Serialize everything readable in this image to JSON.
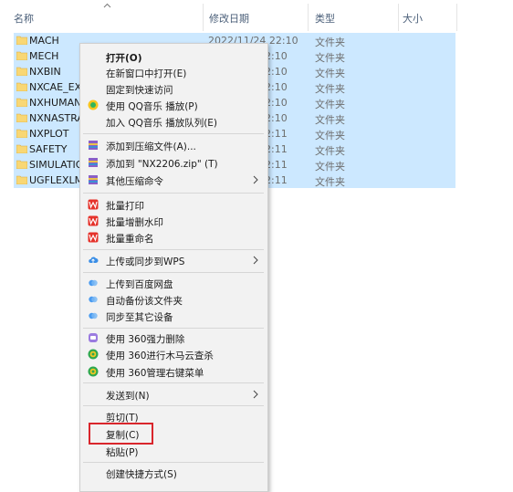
{
  "header": {
    "col_name": "名称",
    "col_date": "修改日期",
    "col_type": "类型",
    "col_size": "大小"
  },
  "files": [
    {
      "name": "MACH",
      "date": "2022/11/24 22:10",
      "type": "文件夹"
    },
    {
      "name": "MECH",
      "date": "2:10",
      "type": "文件夹"
    },
    {
      "name": "NXBIN",
      "date": "2:10",
      "type": "文件夹"
    },
    {
      "name": "NXCAE_EXT",
      "date": "2:10",
      "type": "文件夹"
    },
    {
      "name": "NXHUMAN",
      "date": "2:10",
      "type": "文件夹"
    },
    {
      "name": "NXNASTRA",
      "date": "2:10",
      "type": "文件夹"
    },
    {
      "name": "NXPLOT",
      "date": "2:11",
      "type": "文件夹"
    },
    {
      "name": "SAFETY",
      "date": "2:11",
      "type": "文件夹"
    },
    {
      "name": "SIMULATIO",
      "date": "2:11",
      "type": "文件夹"
    },
    {
      "name": "UGFLEXLM",
      "date": "2:11",
      "type": "文件夹"
    }
  ],
  "menu": {
    "open": "打开(O)",
    "open_new_window": "在新窗口中打开(E)",
    "pin_quick_access": "固定到快速访问",
    "qq_play": "使用 QQ音乐 播放(P)",
    "qq_queue": "加入 QQ音乐 播放队列(E)",
    "add_archive": "添加到压缩文件(A)...",
    "add_zip": "添加到 \"NX2206.zip\" (T)",
    "other_compress": "其他压缩命令",
    "batch_print": "批量打印",
    "batch_watermark": "批量增删水印",
    "batch_rename": "批量重命名",
    "upload_wps": "上传或同步到WPS",
    "upload_baidu": "上传到百度网盘",
    "auto_backup": "自动备份该文件夹",
    "sync_devices": "同步至其它设备",
    "force_delete": "使用 360强力删除",
    "trojan_scan": "使用 360进行木马云查杀",
    "manage_menu": "使用 360管理右键菜单",
    "send_to": "发送到(N)",
    "cut": "剪切(T)",
    "copy": "复制(C)",
    "paste": "粘贴(P)",
    "create_shortcut": "创建快捷方式(S)"
  },
  "colors": {
    "selection": "#cce8ff",
    "menu_bg": "#f2f2f2",
    "highlight_box": "#d9262c",
    "folder": "#f8d775"
  }
}
